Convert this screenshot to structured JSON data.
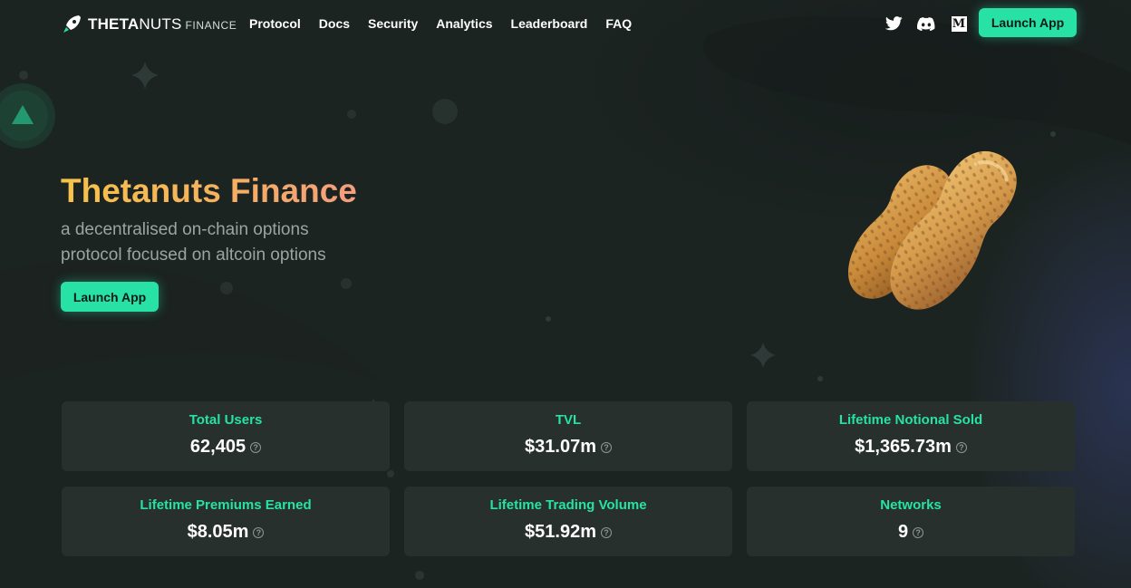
{
  "header": {
    "logo": {
      "primary_bold": "THETA",
      "primary_light": "NUTS",
      "secondary": "FINANCE"
    },
    "nav": [
      "Protocol",
      "Docs",
      "Security",
      "Analytics",
      "Leaderboard",
      "FAQ"
    ],
    "socials": [
      {
        "name": "twitter",
        "icon": "twitter-bird-icon"
      },
      {
        "name": "discord",
        "icon": "discord-controller-icon"
      },
      {
        "name": "medium",
        "icon": "medium-m-icon",
        "glyph": "M"
      }
    ],
    "launch_label": "Launch App"
  },
  "hero": {
    "title": "Thetanuts Finance",
    "subtitle_line1": "a decentralised on-chain options",
    "subtitle_line2": "protocol focused on altcoin options",
    "launch_label": "Launch App",
    "image": "peanut-illustration"
  },
  "stats": [
    {
      "label": "Total Users",
      "value": "62,405"
    },
    {
      "label": "TVL",
      "value": "$31.07m"
    },
    {
      "label": "Lifetime Notional Sold",
      "value": "$1,365.73m"
    },
    {
      "label": "Lifetime Premiums Earned",
      "value": "$8.05m"
    },
    {
      "label": "Lifetime Trading Volume",
      "value": "$51.92m"
    },
    {
      "label": "Networks",
      "value": "9"
    }
  ],
  "help_glyph": "?",
  "colors": {
    "background": "#1c2422",
    "accent_green": "#27e2a4",
    "title_gradient_start": "#f7c34a",
    "title_gradient_end": "#f39d7e",
    "card_background": "#28302e",
    "muted_text": "#9ba4a1"
  }
}
